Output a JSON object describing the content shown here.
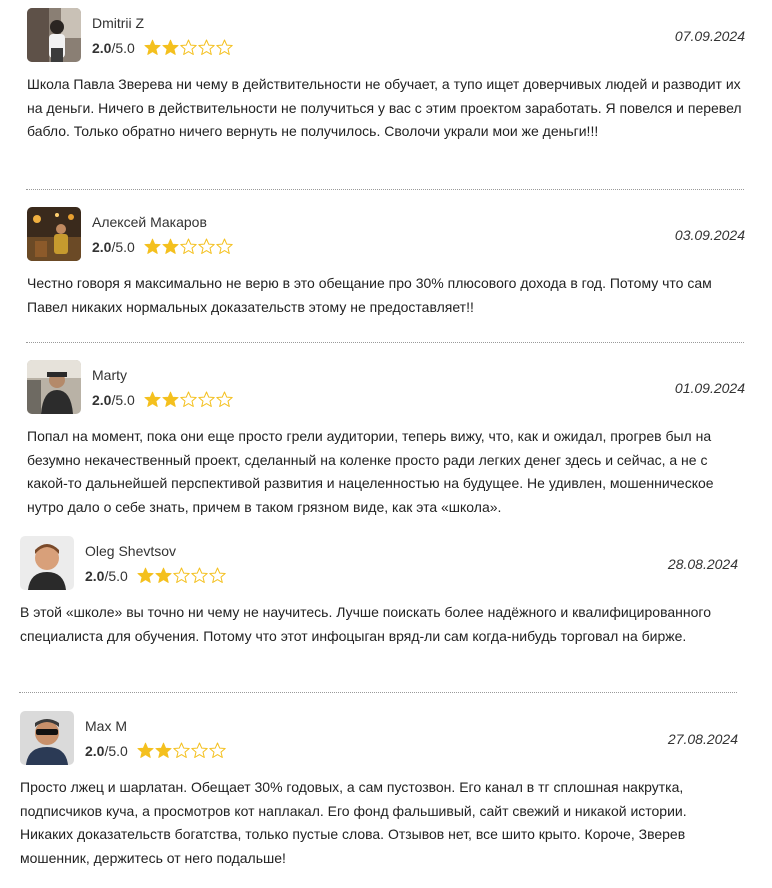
{
  "colors": {
    "star_filled": "#f4c01e",
    "star_empty_stroke": "#f4c01e",
    "divider": "#9a9a9a"
  },
  "reviews": [
    {
      "author": "Dmitrii Z",
      "score": "2.0",
      "max": "/5.0",
      "stars_filled": 2,
      "stars_total": 5,
      "date": "07.09.2024",
      "avatar_icon": "user-photo-avatar",
      "text": "Школа Павла Зверева ни чему в действительности не обучает, а тупо ищет доверчивых людей и разводит их на деньги. Ничего в действительности не получиться у вас с этим проектом заработать. Я повелся и перевел бабло. Только обратно ничего вернуть не получилось. Сволочи украли мои же деньги!!!"
    },
    {
      "author": "Алексей Макаров",
      "score": "2.0",
      "max": "/5.0",
      "stars_filled": 2,
      "stars_total": 5,
      "date": "03.09.2024",
      "avatar_icon": "user-photo-avatar",
      "text": "Честно говоря я максимально не верю в это обещание про 30% плюсового дохода в год. Потому что сам Павел никаких нормальных доказательств этому не предоставляет!!"
    },
    {
      "author": "Marty",
      "score": "2.0",
      "max": "/5.0",
      "stars_filled": 2,
      "stars_total": 5,
      "date": "01.09.2024",
      "avatar_icon": "user-photo-avatar",
      "text": "Попал на момент, пока они еще просто грели аудитории, теперь вижу, что, как и ожидал, прогрев был на безумно некачественный проект, сделанный на коленке просто ради легких денег здесь и сейчас, а не с какой-то дальнейшей перспективой развития и нацеленностью на будущее. Не удивлен, мошенническое нутро дало о себе знать, причем в таком грязном виде, как эта «школа»."
    },
    {
      "author": "Oleg Shevtsov",
      "score": "2.0",
      "max": "/5.0",
      "stars_filled": 2,
      "stars_total": 5,
      "date": "28.08.2024",
      "avatar_icon": "user-photo-avatar",
      "text": "В этой «школе» вы точно ни чему не научитесь. Лучше поискать более надёжного и квалифицированного специалиста для обучения. Потому что этот инфоцыган вряд-ли сам когда-нибудь торговал на бирже."
    },
    {
      "author": "Max M",
      "score": "2.0",
      "max": "/5.0",
      "stars_filled": 2,
      "stars_total": 5,
      "date": "27.08.2024",
      "avatar_icon": "user-photo-avatar",
      "text": "Просто лжец и шарлатан. Обещает 30% годовых, а сам пустозвон. Его канал в тг сплошная накрутка, подписчиков куча, а просмотров кот наплакал. Его фонд фальшивый, сайт свежий и никакой истории. Никаких доказательств богатства, только пустые слова. Отзывов нет, все шито крыто. Короче, Зверев мошенник, держитесь от него подальше!"
    }
  ]
}
